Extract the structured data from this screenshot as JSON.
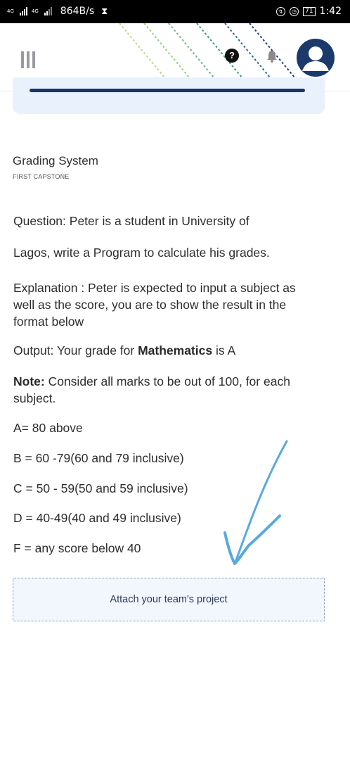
{
  "status_bar": {
    "network_1": "4G",
    "network_2": "4G",
    "speed": "864B/s",
    "battery": "71",
    "time": "1:42"
  },
  "header": {
    "menu_icon": "hamburger-icon",
    "help_icon": "question-circle-icon",
    "help_glyph": "?",
    "bell_icon": "bell-icon",
    "avatar_icon": "user-avatar-icon",
    "brand_color": "#1b3a6b"
  },
  "course": {
    "title": "Grading System",
    "subtitle": "FIRST CAPSTONE"
  },
  "question": {
    "line1": "Question: Peter is a student in University of",
    "line2": "Lagos, write a Program to calculate his grades.",
    "explanation": "Explanation :  Peter is expected to input a subject as well as the  score, you are to show the result in the format below",
    "output_prefix": "Output: Your grade  for ",
    "output_subject": "Mathematics",
    "output_mid": " is ",
    "output_grade": "A",
    "note_label": "Note:",
    "note_text": " Consider all marks to be out of 100, for each subject.",
    "grades": [
      "A= 80 above",
      "B = 60 -79(60 and 79 inclusive)",
      "C = 50 - 59(50 and 59 inclusive)",
      "D = 40-49(40 and 49 inclusive)",
      "F = any score below 40"
    ]
  },
  "attach": {
    "label": "Attach your team's project"
  }
}
